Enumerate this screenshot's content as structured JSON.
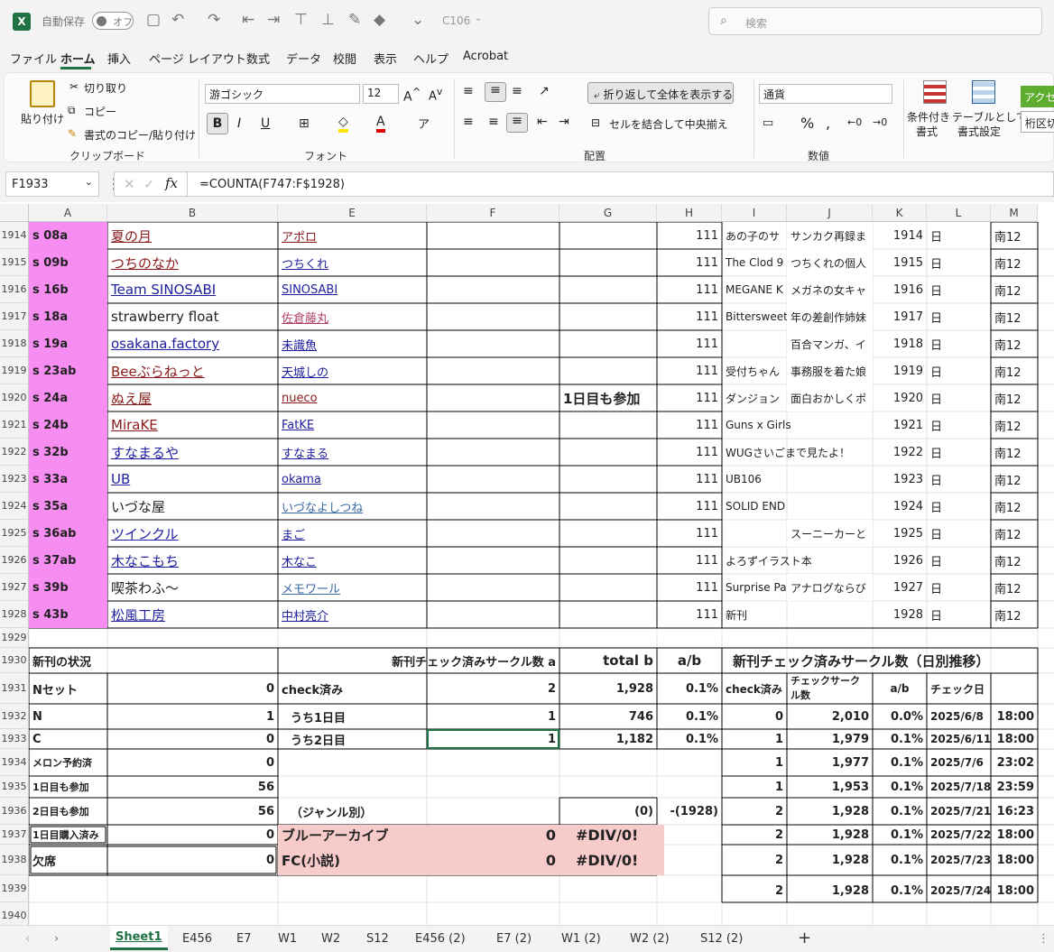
{
  "title_bar": {
    "autosave": "自動保存",
    "autosave_state": "オフ",
    "filename": "C106",
    "search_placeholder": "検索"
  },
  "menu": [
    "ファイル",
    "ホーム",
    "挿入",
    "ページ レイアウト",
    "数式",
    "データ",
    "校閲",
    "表示",
    "ヘルプ",
    "Acrobat"
  ],
  "ribbon": {
    "paste": "貼り付け",
    "cut": "切り取り",
    "copy": "コピー",
    "format_painter": "書式のコピー/貼り付け",
    "clipboard": "クリップボード",
    "font_name": "游ゴシック",
    "font_size": "12",
    "font_group": "フォント",
    "wrap": "折り返して全体を表示する",
    "merge": "セルを結合して中央揃え",
    "align_group": "配置",
    "number_format": "通貨",
    "number_group": "数値",
    "cond_format": "条件付き",
    "cond_format2": "書式",
    "table_format": "テーブルとして",
    "table_format2": "書式設定",
    "styles_partial": "アクセ",
    "styles_partial2": "桁区切"
  },
  "formula_bar": {
    "name_box": "F1933",
    "formula": "=COUNTA(F747:F$1928)"
  },
  "columns": [
    "A",
    "B",
    "E",
    "F",
    "G",
    "H",
    "I",
    "J",
    "K",
    "L",
    "M"
  ],
  "row_numbers": [
    "1914",
    "1915",
    "1916",
    "1917",
    "1918",
    "1919",
    "1920",
    "1921",
    "1922",
    "1923",
    "1924",
    "1925",
    "1926",
    "1927",
    "1928",
    "1929",
    "1930",
    "1931",
    "1932",
    "1933",
    "1934",
    "1935",
    "1936",
    "1937",
    "1938",
    "1939",
    "1940"
  ],
  "circle_rows": [
    {
      "a": "s 08a",
      "b": "夏の月",
      "bs": "lnk red",
      "e": "アポロ",
      "es": "lnk red",
      "g": "",
      "h": "111",
      "i": "あの子のサ",
      "j": "サンカク再録ま",
      "k": "1914",
      "l": "日",
      "m": "南12"
    },
    {
      "a": "s 09b",
      "b": "つちのなか",
      "bs": "lnk red",
      "e": "つちくれ",
      "es": "lnk blu",
      "g": "",
      "h": "111",
      "i": "The Clod 9",
      "j": "つちくれの個人",
      "k": "1915",
      "l": "日",
      "m": "南12"
    },
    {
      "a": "s 16b",
      "b": "Team SINOSABI",
      "bs": "lnk blu",
      "e": "SINOSABI",
      "es": "lnk blu",
      "g": "",
      "h": "111",
      "i": "MEGANE K",
      "j": "メガネの女キャ",
      "k": "1916",
      "l": "日",
      "m": "南12"
    },
    {
      "a": "s 18a",
      "b": "strawberry float",
      "bs": "",
      "e": "佐倉藤丸",
      "es": "lnk pnk",
      "g": "",
      "h": "111",
      "i": "Bittersweet",
      "j": "年の差創作姉妹",
      "k": "1917",
      "l": "日",
      "m": "南12"
    },
    {
      "a": "s 19a",
      "b": "osakana.factory",
      "bs": "lnk blu",
      "e": "未識魚",
      "es": "lnk blu",
      "g": "",
      "h": "111",
      "i": "",
      "j": "百合マンガ、イ",
      "k": "1918",
      "l": "日",
      "m": "南12"
    },
    {
      "a": "s 23ab",
      "b": "Beeぶらねっと",
      "bs": "lnk red",
      "e": "天城しの",
      "es": "lnk blu",
      "g": "",
      "h": "111",
      "i": "受付ちゃん",
      "j": "事務服を着た娘",
      "k": "1919",
      "l": "日",
      "m": "南12"
    },
    {
      "a": "s 24a",
      "b": "ぬえ屋",
      "bs": "lnk red",
      "e": "nueco",
      "es": "lnk red",
      "g": "1日目も参加",
      "h": "111",
      "i": "ダンジョン",
      "j": "面白おかしくポ",
      "k": "1920",
      "l": "日",
      "m": "南12"
    },
    {
      "a": "s 24b",
      "b": "MiraKE",
      "bs": "lnk red",
      "e": "FatKE",
      "es": "lnk blu",
      "g": "",
      "h": "111",
      "i": "Guns x Girls",
      "j": "",
      "k": "1921",
      "l": "日",
      "m": "南12"
    },
    {
      "a": "s 32b",
      "b": "すなまるや",
      "bs": "lnk blu",
      "e": "すなまる",
      "es": "lnk blu",
      "g": "",
      "h": "111",
      "i": "WUGさいごまで見たよ！",
      "j": "",
      "k": "1922",
      "l": "日",
      "m": "南12"
    },
    {
      "a": "s 33a",
      "b": "UB",
      "bs": "lnk blu",
      "e": "okama",
      "es": "lnk blu",
      "g": "",
      "h": "111",
      "i": "UB106",
      "j": "",
      "k": "1923",
      "l": "日",
      "m": "南12"
    },
    {
      "a": "s 35a",
      "b": "いづな屋",
      "bs": "",
      "e": "いづなよしつね",
      "es": "lnk lb",
      "g": "",
      "h": "111",
      "i": "SOLID END",
      "j": "",
      "k": "1924",
      "l": "日",
      "m": "南12"
    },
    {
      "a": "s 36ab",
      "b": "ツインクル",
      "bs": "lnk blu",
      "e": "まご",
      "es": "lnk blu",
      "g": "",
      "h": "111",
      "i": "",
      "j": "スーニーカーと",
      "k": "1925",
      "l": "日",
      "m": "南12"
    },
    {
      "a": "s 37ab",
      "b": "木なこもち",
      "bs": "lnk blu",
      "e": "木なこ",
      "es": "lnk blu",
      "g": "",
      "h": "111",
      "i": "よろずイラスト本",
      "j": "",
      "k": "1926",
      "l": "日",
      "m": "南12"
    },
    {
      "a": "s 39b",
      "b": "喫茶わふ〜",
      "bs": "",
      "e": "メモワール",
      "es": "lnk lb",
      "g": "",
      "h": "111",
      "i": "Surprise Pa",
      "j": "アナログならび",
      "k": "1927",
      "l": "日",
      "m": "南12"
    },
    {
      "a": "s 43b",
      "b": "松風工房",
      "bs": "lnk blu",
      "e": "中村亮介",
      "es": "lnk blu",
      "g": "",
      "h": "111",
      "i": "新刊",
      "j": "",
      "k": "1928",
      "l": "日",
      "m": "南12"
    }
  ],
  "status_table": {
    "title": "新刊の状況",
    "rows": [
      {
        "label": "Nセット",
        "value": "0"
      },
      {
        "label": "N",
        "value": "1"
      },
      {
        "label": "C",
        "value": "0"
      },
      {
        "label": "メロン予約済",
        "value": "0"
      },
      {
        "label": "1日目も参加",
        "value": "56"
      },
      {
        "label": "2日目も参加",
        "value": "56"
      },
      {
        "label": "1日目購入済み",
        "value": "0"
      },
      {
        "label": "欠席",
        "value": "0"
      }
    ]
  },
  "check_table": {
    "header_a": "新刊チェック済みサークル数 a",
    "header_b": "total b",
    "header_ab": "a/b",
    "rows": [
      {
        "label": "check済み",
        "a": "2",
        "b": "1,928",
        "ab": "0.1%"
      },
      {
        "label": "うち1日目",
        "a": "1",
        "b": "746",
        "ab": "0.1%"
      },
      {
        "label": "うち2日目",
        "a": "1",
        "b": "1,182",
        "ab": "0.1%"
      }
    ],
    "genre_label": "（ジャンル別）",
    "genre_g": "(0)",
    "genre_h": "-(1928)",
    "genres": [
      {
        "name": "ブルーアーカイブ",
        "count": "0",
        "ratio": "#DIV/0!"
      },
      {
        "name": "FC(小説)",
        "count": "0",
        "ratio": "#DIV/0!"
      }
    ]
  },
  "trend_table": {
    "title": "新刊チェック済みサークル数（日別推移）",
    "h_checked": "check済み",
    "h_count": "チェックサークル数",
    "h_ab": "a/b",
    "h_date": "チェック日",
    "rows": [
      {
        "checked": "0",
        "count": "2,010",
        "ab": "0.0%",
        "date": "2025/6/8",
        "time": "18:00"
      },
      {
        "checked": "1",
        "count": "1,979",
        "ab": "0.1%",
        "date": "2025/6/11",
        "time": "18:00"
      },
      {
        "checked": "1",
        "count": "1,977",
        "ab": "0.1%",
        "date": "2025/7/6",
        "time": "23:02"
      },
      {
        "checked": "1",
        "count": "1,953",
        "ab": "0.1%",
        "date": "2025/7/18",
        "time": "23:59"
      },
      {
        "checked": "2",
        "count": "1,928",
        "ab": "0.1%",
        "date": "2025/7/21",
        "time": "16:23"
      },
      {
        "checked": "2",
        "count": "1,928",
        "ab": "0.1%",
        "date": "2025/7/22",
        "time": "18:00"
      },
      {
        "checked": "2",
        "count": "1,928",
        "ab": "0.1%",
        "date": "2025/7/23",
        "time": "18:00"
      },
      {
        "checked": "2",
        "count": "1,928",
        "ab": "0.1%",
        "date": "2025/7/24",
        "time": "18:00"
      }
    ]
  },
  "sheet_tabs": [
    "Sheet1",
    "E456",
    "E7",
    "W1",
    "W2",
    "S12",
    "E456 (2)",
    "E7 (2)",
    "W1 (2)",
    "W2 (2)",
    "S12 (2)"
  ],
  "colors": {
    "pink_col": "#f58ef0",
    "salmon": "#f8cbcb",
    "excel_green": "#1f7244",
    "active_tab": "#1f7244"
  }
}
